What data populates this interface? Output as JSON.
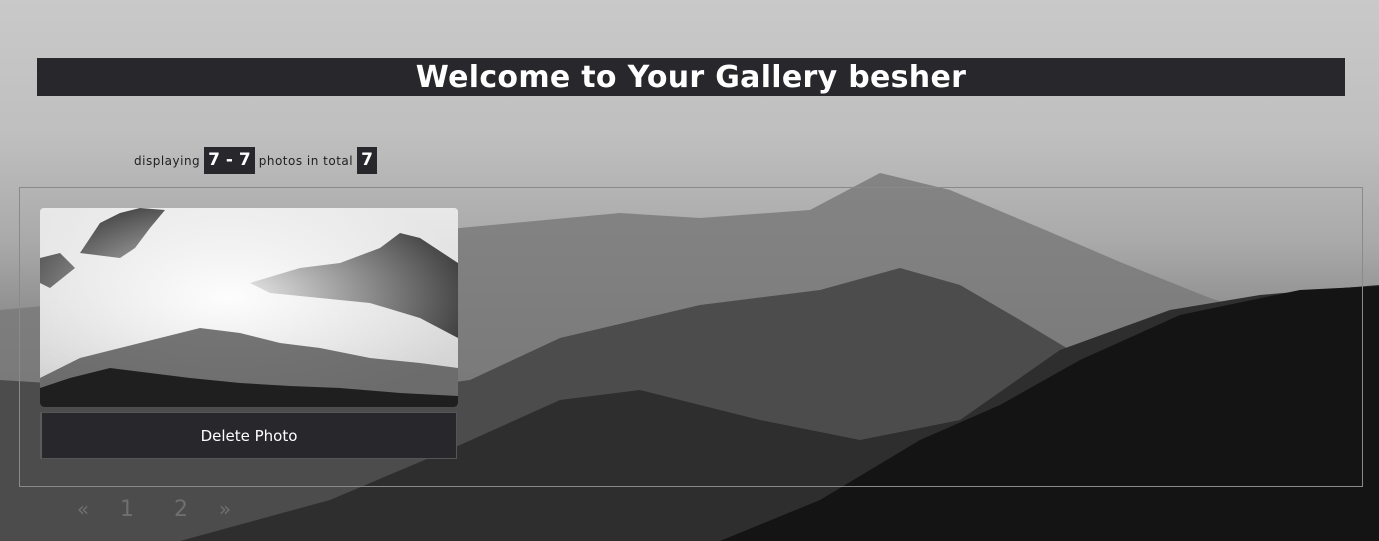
{
  "header": {
    "title": "Welcome to Your Gallery besher"
  },
  "summary": {
    "prefix": "displaying",
    "range": "7 - 7",
    "middle": "photos in total",
    "total": "7"
  },
  "gallery": {
    "photos": [
      {
        "image_icon": "misty-mountain-forest-photo",
        "delete_label": "Delete Photo"
      }
    ]
  },
  "pagination": {
    "prev": "«",
    "pages": [
      "1",
      "2"
    ],
    "next": "»"
  },
  "colors": {
    "bar": "#28272b",
    "text_light": "#ffffff",
    "pagination_text": "#6f6f6f"
  }
}
